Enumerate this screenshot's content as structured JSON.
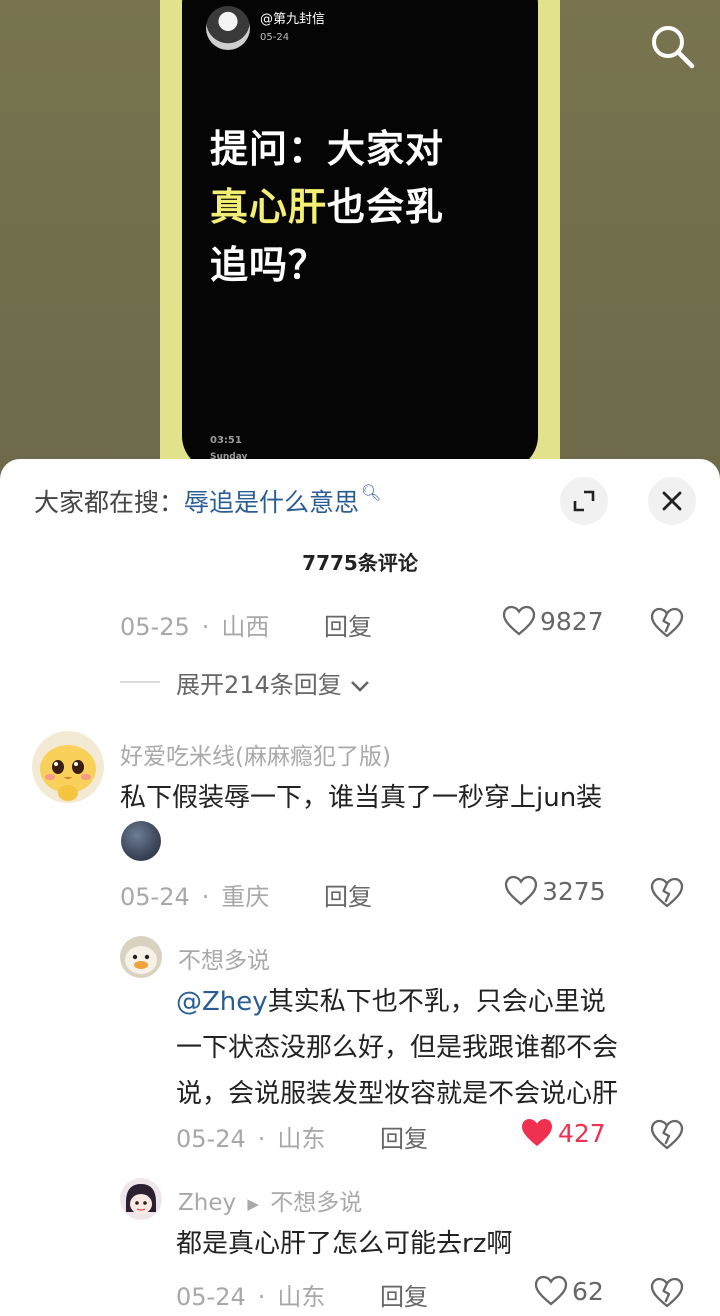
{
  "video": {
    "author": "@第九封信",
    "date": "05-24",
    "headline_part1": "提问：大家对",
    "headline_highlight": "真心肝",
    "headline_part2": "也会乳",
    "headline_part3": "追吗？",
    "clock": "03:51",
    "weekday": "Sunday"
  },
  "sheet": {
    "hot_label": "大家都在搜：",
    "hot_term": "辱追是什么意思",
    "comment_count": "7775条评论"
  },
  "top_comment_footer": {
    "date": "05-25",
    "location": "山西",
    "reply_label": "回复",
    "likes": "9827",
    "expand_label": "展开214条回复"
  },
  "comments": [
    {
      "user": "好爱吃米线(麻麻瘾犯了版)",
      "text": "私下假装辱一下，谁当真了一秒穿上jun装",
      "date": "05-24",
      "location": "重庆",
      "reply_label": "回复",
      "likes": "3275"
    }
  ],
  "replies": [
    {
      "user": "不想多说",
      "mention": "@Zhey",
      "text_line1": "其实私下也不乳，只会心里说",
      "text_line2": "一下状态没那么好，但是我跟谁都不会",
      "text_line3": "说，会说服装发型妆容就是不会说心肝",
      "date": "05-24",
      "location": "山东",
      "reply_label": "回复",
      "likes": "427",
      "liked": true
    },
    {
      "user": "Zhey",
      "reply_to": "不想多说",
      "text": "都是真心肝了怎么可能去rz啊",
      "date": "05-24",
      "location": "山东",
      "reply_label": "回复",
      "likes": "62"
    }
  ],
  "colors": {
    "accent_link": "#2a5d96",
    "liked_red": "#f0304f",
    "highlight_yellow": "#f3ef74"
  }
}
